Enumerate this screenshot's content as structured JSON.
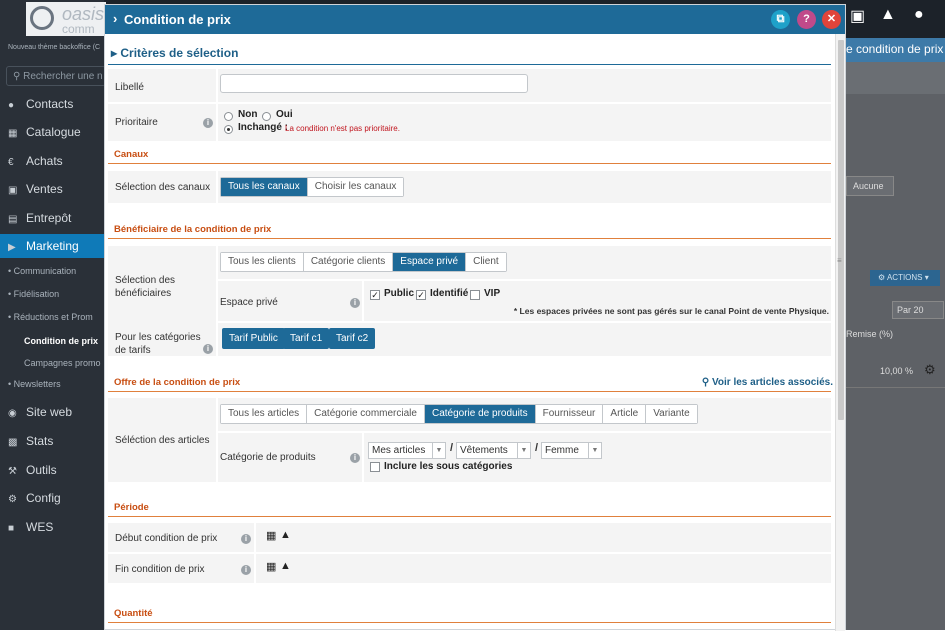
{
  "background": {
    "logo_text": "oasis",
    "logo_text2": "comm",
    "theme_note": "Nouveau thème backoffice (C",
    "search_placeholder": "Rechercher une n",
    "nav": [
      "Contacts",
      "Catalogue",
      "Achats",
      "Ventes",
      "Entrepôt",
      "Marketing",
      "Site web",
      "Stats",
      "Outils",
      "Config",
      "WES"
    ],
    "nav_icons": [
      "user-icon",
      "book-icon",
      "euro-icon",
      "cart-icon",
      "warehouse-icon",
      "megaphone-icon",
      "globe-icon",
      "chart-icon",
      "wrench-icon",
      "gear-icon",
      "lock-icon"
    ],
    "sub_nav": [
      "Communication",
      "Fidélisation",
      "Réductions et Prom",
      "Condition de prix",
      "Campagnes promo",
      "Newsletters"
    ],
    "right_header": "e condition de prix",
    "right_aucune": "Aucune",
    "right_actions": "ACTIONS",
    "right_par": "Par 20",
    "right_remise": "Remise (%)",
    "right_pct": "10,00 %"
  },
  "modal": {
    "title": "Condition de prix",
    "section_title": "Critères de sélection",
    "libelle": {
      "label": "Libellé",
      "value": ""
    },
    "prioritaire": {
      "label": "Prioritaire",
      "options": [
        "Non",
        "Oui",
        "Inchangé :"
      ],
      "selected": "Inchangé :",
      "note": "La condition n'est pas prioritaire."
    },
    "canaux": {
      "group": "Canaux",
      "label": "Sélection des canaux",
      "options": [
        "Tous les canaux",
        "Choisir les canaux"
      ],
      "selected": "Tous les canaux"
    },
    "beneficiaire": {
      "group": "Bénéficiaire de la condition de prix",
      "label": "Sélection des bénéficiaires",
      "options": [
        "Tous les clients",
        "Catégorie clients",
        "Espace privé",
        "Client"
      ],
      "selected": "Espace privé",
      "espace_label": "Espace privé",
      "checks": [
        {
          "label": "Public",
          "checked": true
        },
        {
          "label": "Identifié",
          "checked": true
        },
        {
          "label": "VIP",
          "checked": false
        }
      ],
      "note": "* Les espaces privées ne sont pas gérés sur le canal Point de vente Physique.",
      "tarifs_label": "Pour les catégories de tarifs",
      "tarifs": [
        "Tarif Public",
        "Tarif c1",
        "Tarif c2"
      ]
    },
    "offre": {
      "group": "Offre de la condition de prix",
      "link": "Voir les articles associés.",
      "label": "Séléction des articles",
      "options": [
        "Tous les articles",
        "Catégorie commerciale",
        "Catégorie de produits",
        "Fournisseur",
        "Article",
        "Variante"
      ],
      "selected": "Catégorie de produits",
      "cat_label": "Catégorie de produits",
      "selects": [
        "Mes articles",
        "Vêtements",
        "Femme"
      ],
      "include": "Inclure les sous catégories",
      "include_checked": false
    },
    "periode": {
      "group": "Période",
      "debut": "Début condition de prix",
      "fin": "Fin condition de prix"
    },
    "quantite": {
      "group": "Quantité"
    }
  },
  "colors": {
    "primary": "#1e6a98",
    "orange": "#e0803c",
    "danger": "#e0443a",
    "help": "#c04a8a",
    "copy": "#1fa1c9"
  }
}
